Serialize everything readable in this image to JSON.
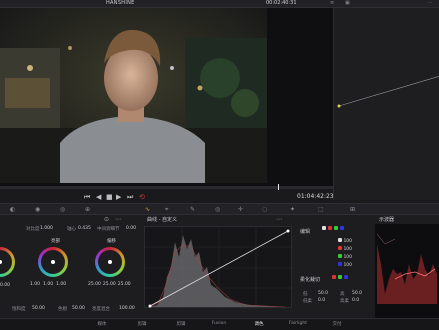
{
  "app": {
    "project_name": "HANSHINE",
    "top_timecode": "00:02:40:31"
  },
  "viewer": {
    "timecode": "01:04:42:23"
  },
  "curves": {
    "title": "曲线 - 自定义"
  },
  "primaries": {
    "labels": {
      "contrast": "对比度",
      "pivot": "轴心",
      "mid_detail": "中间调细节"
    },
    "values": {
      "contrast": "1.000",
      "pivot": "0.435",
      "mid_detail": "0.00"
    },
    "wheels": [
      {
        "name": "暗部",
        "values": [
          "0.00",
          "0.00",
          "0.00",
          "0.00"
        ]
      },
      {
        "name": "亮部",
        "values": [
          "1.00",
          "1.00",
          "1.00",
          "1.00"
        ]
      },
      {
        "name": "偏移",
        "values": [
          "25.00",
          "25.00",
          "25.00",
          "25.00"
        ]
      }
    ],
    "bottom": {
      "saturation_label": "饱和度",
      "saturation": "50.00",
      "hue_label": "色相",
      "hue": "50.00",
      "lum_mix_label": "亮度混合",
      "lum_mix": "100.00"
    }
  },
  "edit_panel": {
    "title": "编辑",
    "channels": [
      {
        "value": "100"
      },
      {
        "value": "100"
      },
      {
        "value": "100"
      },
      {
        "value": "100"
      }
    ],
    "soft_clip_title": "柔化裁切",
    "low": "50.0",
    "high": "50.0",
    "low_label": "低",
    "high_label": "高",
    "ls_label": "低柔",
    "hs_label": "高柔",
    "ls": "0.0",
    "hs": "0.0"
  },
  "scopes": {
    "title": "示波器"
  },
  "bottom_nav": [
    {
      "label": "媒体",
      "active": false
    },
    {
      "label": "剪辑",
      "active": false
    },
    {
      "label": "剪辑",
      "active": false
    },
    {
      "label": "Fusion",
      "active": false
    },
    {
      "label": "调色",
      "active": true
    },
    {
      "label": "Fairlight",
      "active": false
    },
    {
      "label": "交付",
      "active": false
    }
  ],
  "colors": {
    "accent": "#e3a33a",
    "record": "#d03a3a",
    "background": "#1b1b1d"
  }
}
